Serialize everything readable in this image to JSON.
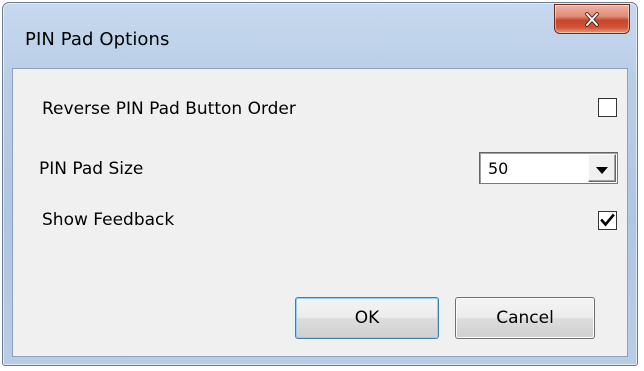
{
  "window": {
    "title": "PIN Pad Options",
    "close_glyph": "close-icon"
  },
  "options": {
    "reverse_order": {
      "label": "Reverse PIN Pad Button Order",
      "checked": false
    },
    "pad_size": {
      "label": "PIN Pad Size",
      "value": "50"
    },
    "show_feedback": {
      "label": "Show Feedback",
      "checked": true
    }
  },
  "buttons": {
    "ok_label": "OK",
    "cancel_label": "Cancel"
  },
  "colors": {
    "title_bar": "#b9cde6",
    "close_button": "#c7452a",
    "client_background": "#f0f0f0",
    "default_button_border": "#3c7fb1"
  }
}
